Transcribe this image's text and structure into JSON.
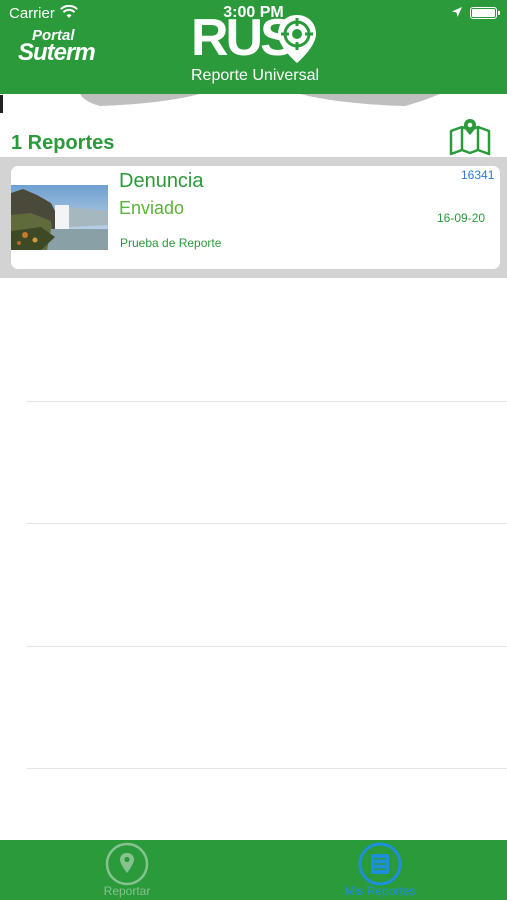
{
  "status_bar": {
    "carrier": "Carrier",
    "time": "3:00 PM"
  },
  "header": {
    "portal_line1": "Portal",
    "portal_line2": "Suterm",
    "app_title": "RUS",
    "app_subtitle": "Reporte Universal"
  },
  "reports": {
    "count_label": "1 Reportes",
    "items": [
      {
        "title": "Denuncia",
        "status": "Enviado",
        "description": "Prueba de Reporte",
        "id": "16341",
        "date": "16-09-20",
        "thumbnail": "waterfall-photo"
      }
    ]
  },
  "tabbar": {
    "tabs": [
      {
        "label": "Reportar",
        "icon": "location-pin-icon"
      },
      {
        "label": "Mis Reportes",
        "icon": "list-icon",
        "selected": true
      }
    ]
  },
  "colors": {
    "brand_green": "#2a9a3a",
    "status_green": "#5bb33c",
    "id_blue": "#2e7ad8",
    "tab_active_blue": "#1e8fdb"
  }
}
